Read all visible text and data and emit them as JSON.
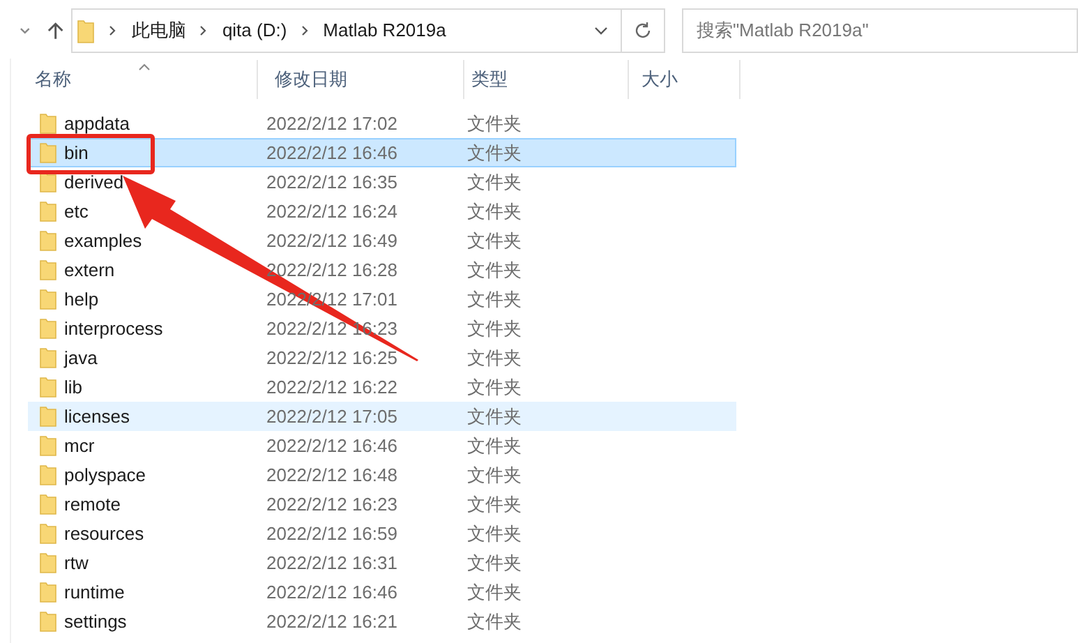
{
  "address_bar": {
    "crumbs": [
      "此电脑",
      "qita (D:)",
      "Matlab R2019a"
    ]
  },
  "search": {
    "placeholder": "搜索\"Matlab R2019a\""
  },
  "table": {
    "columns": [
      "名称",
      "修改日期",
      "类型",
      "大小"
    ],
    "rows": [
      {
        "name": "appdata",
        "modified": "2022/2/12 17:02",
        "type": "文件夹",
        "selected": false,
        "hovered": false
      },
      {
        "name": "bin",
        "modified": "2022/2/12 16:46",
        "type": "文件夹",
        "selected": true,
        "hovered": false
      },
      {
        "name": "derived",
        "modified": "2022/2/12 16:35",
        "type": "文件夹",
        "selected": false,
        "hovered": false
      },
      {
        "name": "etc",
        "modified": "2022/2/12 16:24",
        "type": "文件夹",
        "selected": false,
        "hovered": false
      },
      {
        "name": "examples",
        "modified": "2022/2/12 16:49",
        "type": "文件夹",
        "selected": false,
        "hovered": false
      },
      {
        "name": "extern",
        "modified": "2022/2/12 16:28",
        "type": "文件夹",
        "selected": false,
        "hovered": false
      },
      {
        "name": "help",
        "modified": "2022/2/12 17:01",
        "type": "文件夹",
        "selected": false,
        "hovered": false
      },
      {
        "name": "interprocess",
        "modified": "2022/2/12 16:23",
        "type": "文件夹",
        "selected": false,
        "hovered": false
      },
      {
        "name": "java",
        "modified": "2022/2/12 16:25",
        "type": "文件夹",
        "selected": false,
        "hovered": false
      },
      {
        "name": "lib",
        "modified": "2022/2/12 16:22",
        "type": "文件夹",
        "selected": false,
        "hovered": false
      },
      {
        "name": "licenses",
        "modified": "2022/2/12 17:05",
        "type": "文件夹",
        "selected": false,
        "hovered": true
      },
      {
        "name": "mcr",
        "modified": "2022/2/12 16:46",
        "type": "文件夹",
        "selected": false,
        "hovered": false
      },
      {
        "name": "polyspace",
        "modified": "2022/2/12 16:48",
        "type": "文件夹",
        "selected": false,
        "hovered": false
      },
      {
        "name": "remote",
        "modified": "2022/2/12 16:23",
        "type": "文件夹",
        "selected": false,
        "hovered": false
      },
      {
        "name": "resources",
        "modified": "2022/2/12 16:59",
        "type": "文件夹",
        "selected": false,
        "hovered": false
      },
      {
        "name": "rtw",
        "modified": "2022/2/12 16:31",
        "type": "文件夹",
        "selected": false,
        "hovered": false
      },
      {
        "name": "runtime",
        "modified": "2022/2/12 16:46",
        "type": "文件夹",
        "selected": false,
        "hovered": false
      },
      {
        "name": "settings",
        "modified": "2022/2/12 16:21",
        "type": "文件夹",
        "selected": false,
        "hovered": false
      }
    ]
  }
}
